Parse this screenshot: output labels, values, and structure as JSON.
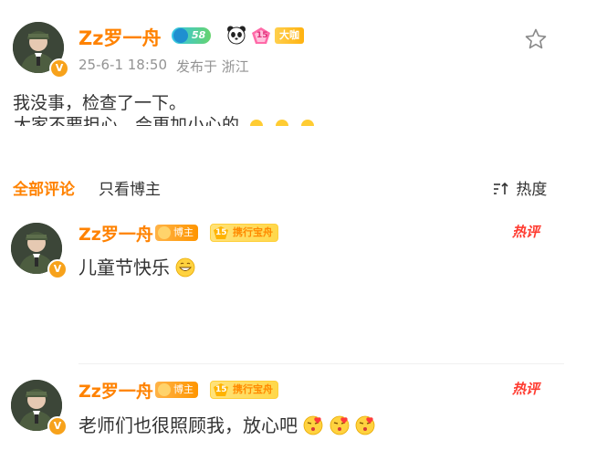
{
  "post": {
    "author": "Zz罗一舟",
    "level": "58",
    "fan_level_number": "15",
    "vip_label": "大咖",
    "timestamp": "25-6-1 18:50",
    "location": "发布于 浙江",
    "text_line1": "我没事，检查了一下。",
    "text_line2": "大家不要担心，会更加小心的"
  },
  "tabs": {
    "all_comments": "全部评论",
    "author_only": "只看博主",
    "sort_label": "热度",
    "sort_icon": "sort-icon"
  },
  "comments": [
    {
      "author": "Zz罗一舟",
      "role_tag": "博主",
      "fan_level": "15",
      "fan_tag": "携行宝舟",
      "text": "儿童节快乐",
      "hot_label": "热评"
    },
    {
      "author": "Zz罗一舟",
      "role_tag": "博主",
      "fan_level": "15",
      "fan_tag": "携行宝舟",
      "text": "老师们也很照顾我，放心吧",
      "hot_label": "热评"
    }
  ],
  "colors": {
    "accent": "#ff8200",
    "hot": "#ff3b30",
    "muted": "#939393"
  }
}
